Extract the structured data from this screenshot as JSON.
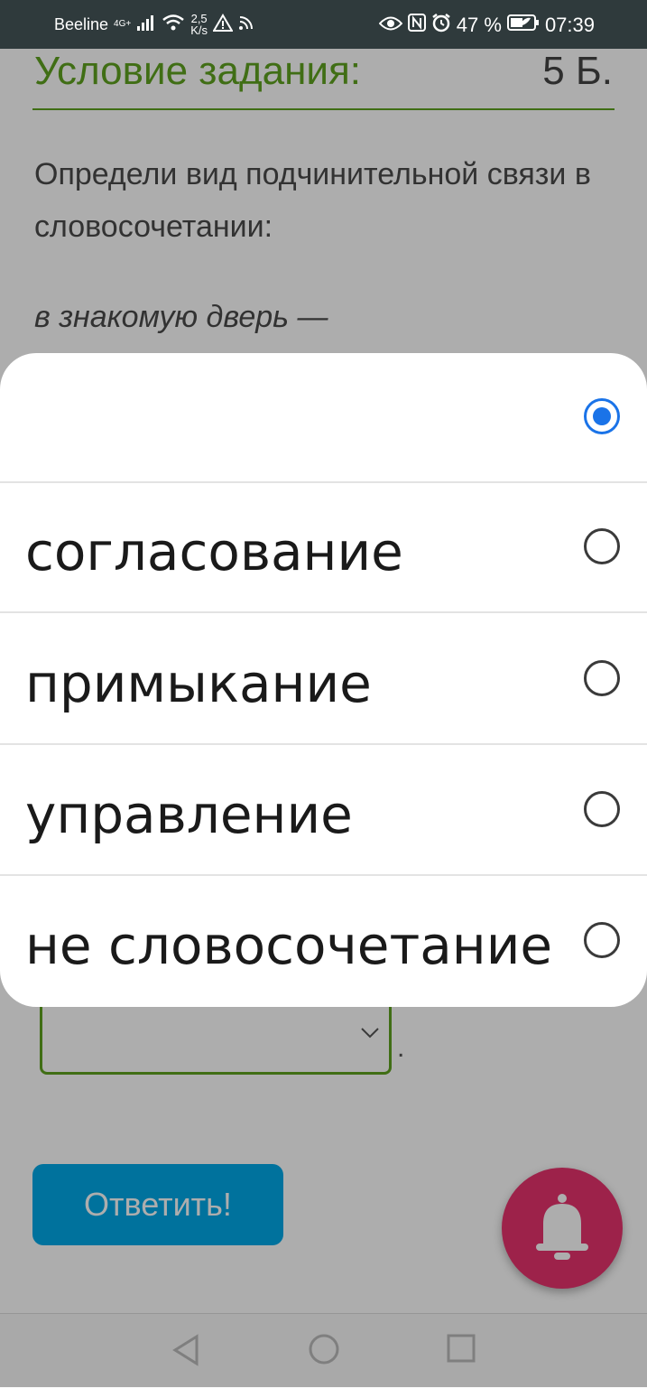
{
  "status_bar": {
    "carrier": "Beeline",
    "network": "4G+",
    "speed_value": "2,5",
    "speed_unit": "K/s",
    "battery": "47 %",
    "time": "07:39"
  },
  "task": {
    "title": "Условие задания:",
    "points": "5 Б.",
    "text": "Определи вид подчинительной связи в словосочетании:",
    "phrase": "в знакомую дверь —",
    "trailing_dot": "."
  },
  "dropdown": {
    "options": [
      {
        "label": "",
        "selected": true
      },
      {
        "label": "согласование",
        "selected": false
      },
      {
        "label": "примыкание",
        "selected": false
      },
      {
        "label": "управление",
        "selected": false
      },
      {
        "label": "не словосочетание",
        "selected": false
      }
    ]
  },
  "answer_button": {
    "label": "Ответить!"
  },
  "icons": {
    "bell": "bell-icon",
    "chevron": "chevron-down-icon",
    "back": "back-icon",
    "home": "home-icon",
    "recents": "recents-icon"
  },
  "colors": {
    "accent_green": "#5fa21f",
    "button_blue": "#00a8e8",
    "bell_pink": "#e8336e",
    "radio_selected": "#1a73e8"
  }
}
